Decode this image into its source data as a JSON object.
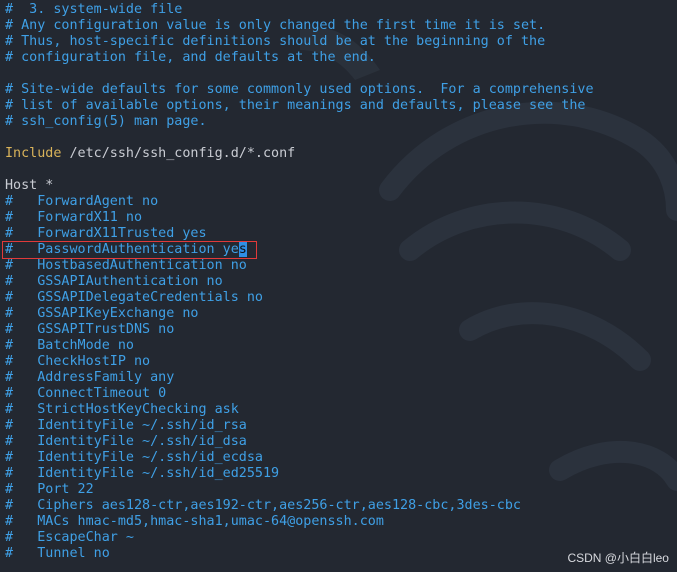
{
  "lines": [
    {
      "hash": "#",
      "text": "  3. system-wide file"
    },
    {
      "hash": "#",
      "text": " Any configuration value is only changed the first time it is set."
    },
    {
      "hash": "#",
      "text": " Thus, host-specific definitions should be at the beginning of the"
    },
    {
      "hash": "#",
      "text": " configuration file, and defaults at the end."
    },
    {
      "hash": "#",
      "text": " Site-wide defaults for some commonly used options.  For a comprehensive"
    },
    {
      "hash": "#",
      "text": " list of available options, their meanings and defaults, please see the"
    },
    {
      "hash": "#",
      "text": " ssh_config(5) man page."
    }
  ],
  "include": {
    "keyword": "Include",
    "path": " /etc/ssh/ssh_config.d/*.conf"
  },
  "host": "Host *",
  "options": [
    {
      "hash": "#",
      "text": "   ForwardAgent no"
    },
    {
      "hash": "#",
      "text": "   ForwardX11 no"
    },
    {
      "hash": "#",
      "text": "   ForwardX11Trusted yes"
    },
    {
      "hash": "#",
      "text_before_cursor": "   PasswordAuthentication ye",
      "cursor_char": "s"
    },
    {
      "hash": "#",
      "text": "   HostbasedAuthentication no"
    },
    {
      "hash": "#",
      "text": "   GSSAPIAuthentication no"
    },
    {
      "hash": "#",
      "text": "   GSSAPIDelegateCredentials no"
    },
    {
      "hash": "#",
      "text": "   GSSAPIKeyExchange no"
    },
    {
      "hash": "#",
      "text": "   GSSAPITrustDNS no"
    },
    {
      "hash": "#",
      "text": "   BatchMode no"
    },
    {
      "hash": "#",
      "text": "   CheckHostIP no"
    },
    {
      "hash": "#",
      "text": "   AddressFamily any"
    },
    {
      "hash": "#",
      "text": "   ConnectTimeout 0"
    },
    {
      "hash": "#",
      "text": "   StrictHostKeyChecking ask"
    },
    {
      "hash": "#",
      "text": "   IdentityFile ~/.ssh/id_rsa"
    },
    {
      "hash": "#",
      "text": "   IdentityFile ~/.ssh/id_dsa"
    },
    {
      "hash": "#",
      "text": "   IdentityFile ~/.ssh/id_ecdsa"
    },
    {
      "hash": "#",
      "text": "   IdentityFile ~/.ssh/id_ed25519"
    },
    {
      "hash": "#",
      "text": "   Port 22"
    },
    {
      "hash": "#",
      "text": "   Ciphers aes128-ctr,aes192-ctr,aes256-ctr,aes128-cbc,3des-cbc"
    },
    {
      "hash": "#",
      "text": "   MACs hmac-md5,hmac-sha1,umac-64@openssh.com"
    },
    {
      "hash": "#",
      "text": "   EscapeChar ~"
    },
    {
      "hash": "#",
      "text": "   Tunnel no"
    }
  ],
  "watermark": "CSDN @小白白leo",
  "colors": {
    "background": "#232831",
    "comment": "#3fa0e6",
    "keyword": "#d9b35a",
    "text": "#c9ccd3",
    "cursor": "#2f8fe6",
    "highlight_border": "#e03a3a"
  }
}
